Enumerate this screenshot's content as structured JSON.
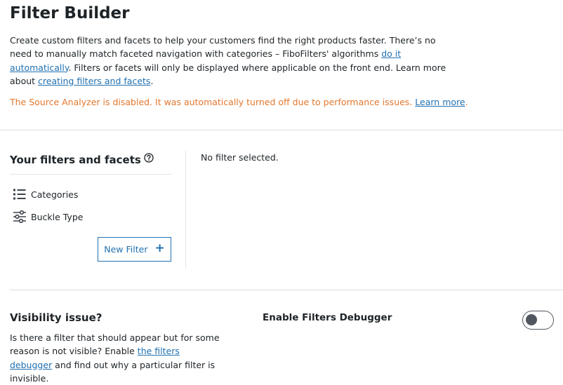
{
  "header": {
    "title": "Filter Builder",
    "intro_1": "Create custom filters and facets to help your customers find the right products faster. There’s no need to manually match faceted navigation with categories – FiboFilters' algorithms ",
    "intro_link_1": "do it automatically",
    "intro_2": ". Filters or facets will only be displayed where applicable on the front end. Learn more about ",
    "intro_link_2": "creating filters and facets",
    "intro_3": ".",
    "warning_text": "The Source Analyzer is disabled. It was automatically turned off due to performance issues. ",
    "warning_link": "Learn more",
    "warning_end": "."
  },
  "filters_panel": {
    "title": "Your filters and facets",
    "help_icon": "question-circle-icon",
    "items": [
      {
        "label": "Categories",
        "icon": "list-icon"
      },
      {
        "label": "Buckle Type",
        "icon": "sliders-icon"
      }
    ],
    "new_filter_label": "New Filter",
    "new_filter_icon": "plus-icon",
    "empty_message": "No filter selected."
  },
  "visibility": {
    "title": "Visibility issue?",
    "text_1": "Is there a filter that should appear but for some reason is not visible? Enable ",
    "link": "the filters debugger",
    "text_2": " and find out why a particular filter is invisible.",
    "debugger_label": "Enable Filters Debugger",
    "debugger_enabled": false
  },
  "colors": {
    "link": "#2271b1",
    "warning": "#e2772e",
    "text": "#1d2327",
    "toggle": "#50575e"
  }
}
